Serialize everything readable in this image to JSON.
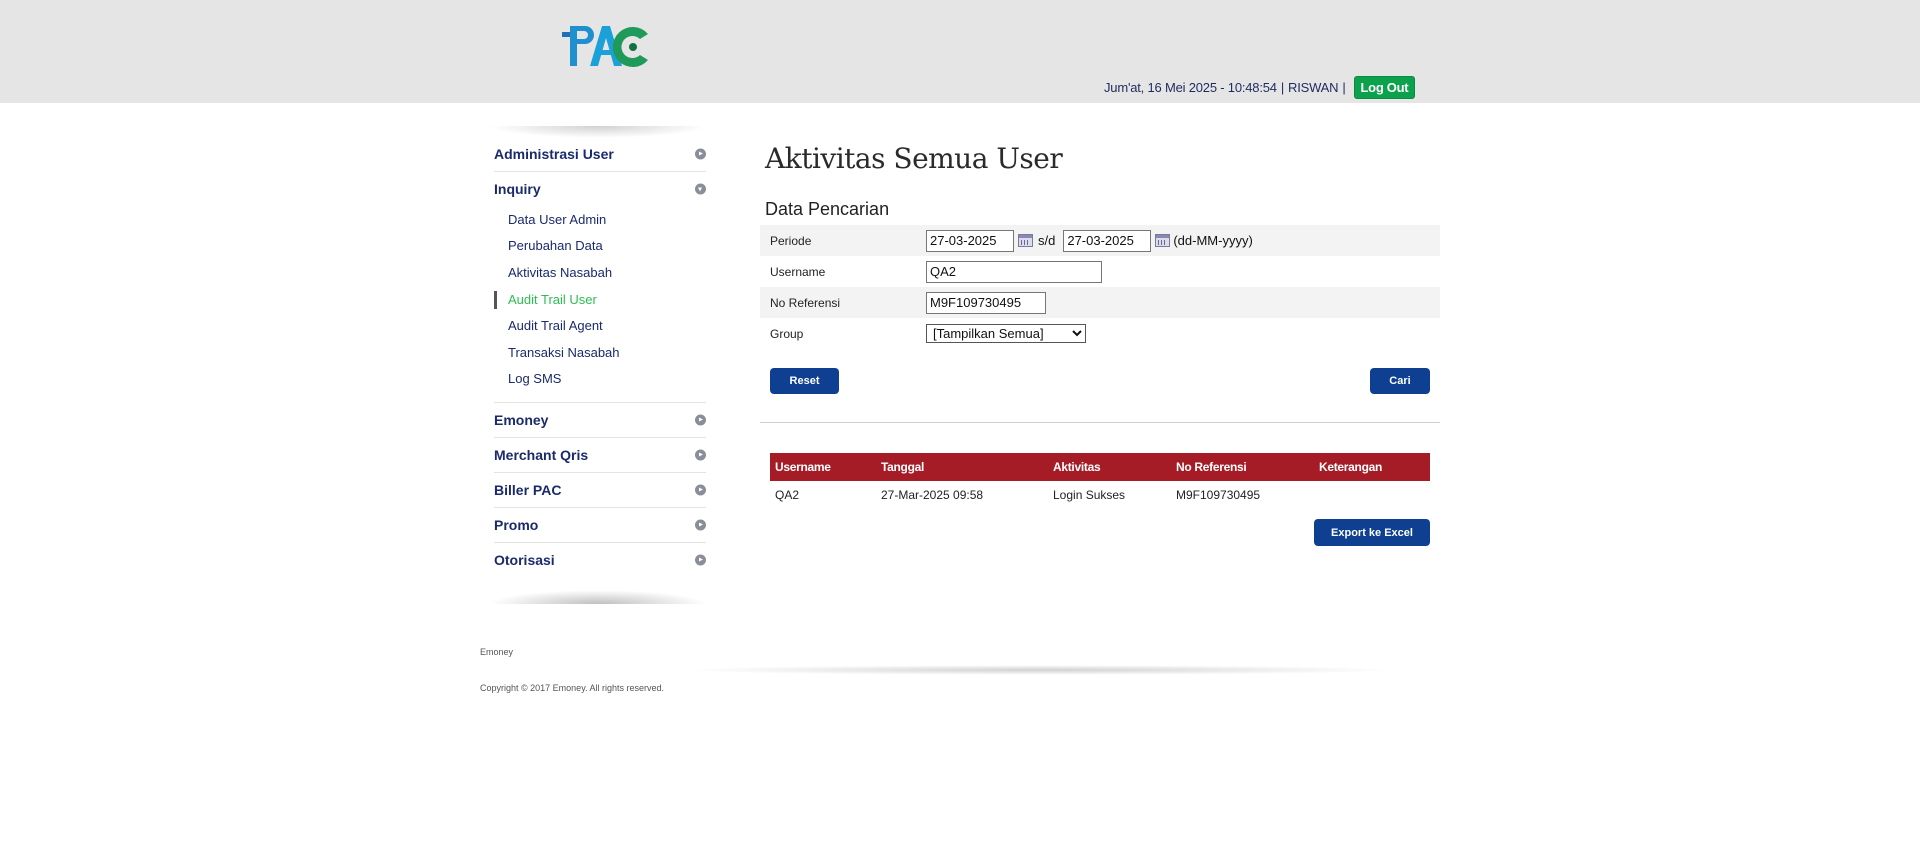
{
  "header": {
    "logo_text": "PAC",
    "datetime": "Jum'at, 16 Mei 2025 - 10:48:54",
    "separator": "|",
    "username": "RISWAN",
    "logout_label": "Log Out"
  },
  "sidebar": {
    "items_before": [
      {
        "label": "Administrasi User"
      }
    ],
    "inquiry": {
      "label": "Inquiry",
      "subitems": [
        {
          "label": "Data User Admin"
        },
        {
          "label": "Perubahan Data"
        },
        {
          "label": "Aktivitas Nasabah"
        },
        {
          "label": "Audit Trail User"
        },
        {
          "label": "Audit Trail Agent"
        },
        {
          "label": "Transaksi Nasabah"
        },
        {
          "label": "Log SMS"
        }
      ]
    },
    "items_after": [
      {
        "label": "Emoney"
      },
      {
        "label": "Merchant Qris"
      },
      {
        "label": "Biller PAC"
      },
      {
        "label": "Promo"
      },
      {
        "label": "Otorisasi"
      }
    ]
  },
  "main": {
    "title": "Aktivitas Semua User",
    "section_title": "Data Pencarian",
    "form": {
      "periode_label": "Periode",
      "date_from": "27-03-2025",
      "sd_label": "s/d",
      "date_to": "27-03-2025",
      "date_format": "(dd-MM-yyyy)",
      "username_label": "Username",
      "username_value": "QA2",
      "ref_label": "No Referensi",
      "ref_value": "M9F109730495",
      "group_label": "Group",
      "group_selected": "[Tampilkan Semua]"
    },
    "reset_label": "Reset",
    "search_label": "Cari",
    "table": {
      "headers": [
        "Username",
        "Tanggal",
        "Aktivitas",
        "No Referensi",
        "Keterangan"
      ],
      "rows": [
        [
          "QA2",
          "27-Mar-2025 09:58",
          "Login Sukses",
          "M9F109730495",
          ""
        ]
      ]
    },
    "export_label": "Export ke Excel"
  },
  "footer": {
    "name": "Emoney",
    "copyright": "Copyright © 2017 Emoney. All rights reserved."
  },
  "colors": {
    "header_bg": "#e6e5e6",
    "nav_text": "#1a2a6c",
    "active_green": "#2bbf4f",
    "button_blue": "#0e3f91",
    "table_header_red": "#a51c26",
    "logout_green": "#0ca14d"
  }
}
